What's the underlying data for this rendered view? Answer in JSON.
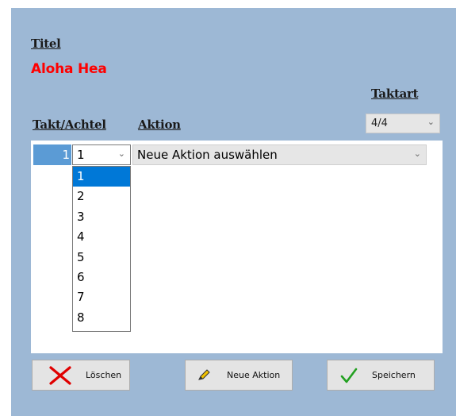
{
  "form": {
    "title_label": "Titel",
    "title_value": "Aloha Hea",
    "taktart_label": "Taktart",
    "taktart_value": "4/4",
    "col_takt": "Takt/Achtel",
    "col_aktion": "Aktion"
  },
  "row": {
    "number": "1",
    "beat": "1",
    "action": "Neue Aktion auswählen"
  },
  "beat_options": [
    "1",
    "2",
    "3",
    "4",
    "5",
    "6",
    "7",
    "8"
  ],
  "beat_selected": "1",
  "buttons": {
    "delete": "Löschen",
    "new_action": "Neue Aktion",
    "save": "Speichern"
  },
  "colors": {
    "panel": "#9db8d5",
    "title": "#ff0000",
    "selection": "#0078d7",
    "row_header": "#5b9bd5"
  },
  "icons": {
    "delete": "x-icon",
    "new_action": "pencil-icon",
    "save": "checkmark-icon",
    "dropdown": "chevron-down-icon"
  }
}
